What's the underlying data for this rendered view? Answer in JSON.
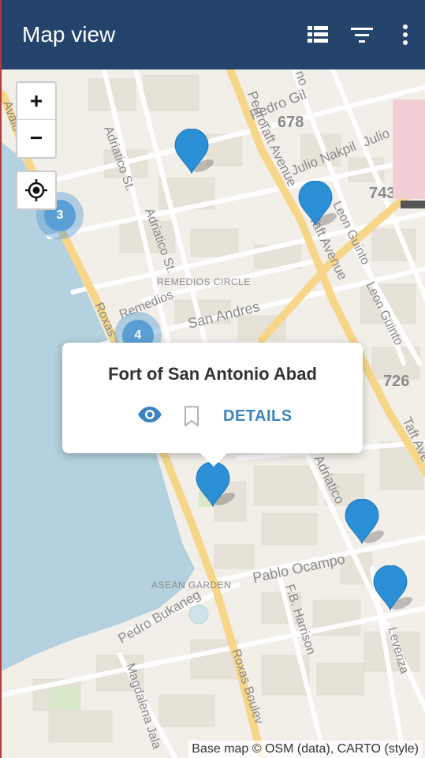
{
  "appbar": {
    "title": "Map view",
    "icons": [
      "list-icon",
      "filter-icon",
      "more-vert-icon"
    ],
    "background": "#24446b"
  },
  "map": {
    "zoom_in_label": "+",
    "zoom_out_label": "−",
    "street_labels": {
      "pedro_gil": "Pedro Gil",
      "num_678": "678",
      "julio_nakpil": "Julio Nakpil",
      "julio": "Julio",
      "num_743": "743",
      "taft_avenue_1": "Taft Avenue",
      "taft_avenue_2": "Taft Avenue",
      "taft_avenue_3": "Taft Ave",
      "leon_guinto_1": "Leon Guinto",
      "leon_guinto_2": "Leon Guinto",
      "adriatico_st_1": "Adriatico St.",
      "adriatico_st_2": "Adriatico St.",
      "adriatico_3": "Adriatico",
      "remedios_circle": "REMEDIOS CIRCLE",
      "remedios": "Remedios",
      "san_andres": "San Andres",
      "roxas": "Roxas",
      "roxas_boulevard": "Roxas Boulev",
      "num_726": "726",
      "pablo_ocampo": "Pablo Ocampo",
      "asean_garden": "ASEAN GARDEN",
      "pedro_bukaneg": "Pedro Bukaneg",
      "fb_harrison": "F.B. Harrison",
      "magdalena_jalandoni": "Magdalena Jala",
      "leveriza": "Leveriza",
      "avalo": "Avalo",
      "pedro_top": "Pedro",
      "no_top": "no"
    },
    "clusters": [
      {
        "count": "3"
      },
      {
        "count": "4"
      }
    ],
    "marker_count": 5,
    "marker_color": "#2b8fd6",
    "water_color": "#b3d1de",
    "major_road_color": "#f7d68a"
  },
  "popup": {
    "title": "Fort of San Antonio Abad",
    "details_label": "DETAILS",
    "view_icon": "eye-icon",
    "bookmark_icon": "bookmark-icon",
    "accent": "#3a82c0"
  },
  "attribution": "Base map © OSM (data), CARTO (style)"
}
